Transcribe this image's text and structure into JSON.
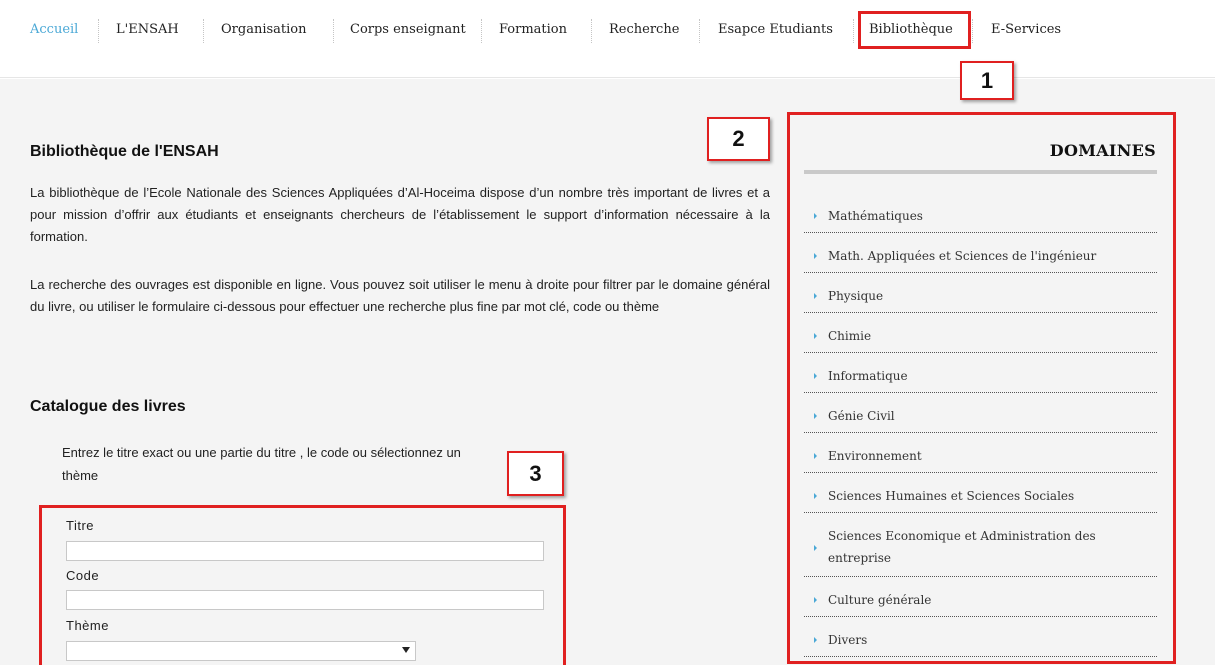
{
  "nav": {
    "items": [
      {
        "label": "Accueil",
        "active": true
      },
      {
        "label": "L'ENSAH",
        "active": false
      },
      {
        "label": "Organisation",
        "active": false
      },
      {
        "label": "Corps enseignant",
        "active": false
      },
      {
        "label": "Formation",
        "active": false
      },
      {
        "label": "Recherche",
        "active": false
      },
      {
        "label": "Esapce Etudiants",
        "active": false
      },
      {
        "label": "Bibliothèque",
        "active": false
      },
      {
        "label": "E-Services",
        "active": false
      }
    ]
  },
  "callouts": [
    "1",
    "2",
    "3"
  ],
  "main": {
    "title": "Bibliothèque de l'ENSAH",
    "paragraph1": "La bibliothèque de l’Ecole Nationale des Sciences Appliquées d’Al-Hoceima dispose d’un nombre très important de livres et a pour mission d’offrir aux étudiants et enseignants chercheurs de l’établissement le support d’information nécessaire à la formation.",
    "paragraph2": "La recherche des ouvrages est disponible en ligne. Vous pouvez soit utiliser le menu à droite pour filtrer par le domaine général du livre, ou utiliser le formulaire ci-dessous pour effectuer une recherche plus fine par mot clé, code ou thème",
    "catalogue_title": "Catalogue des livres",
    "instructions": "Entrez le titre exact ou une partie du titre , le code ou sélectionnez un thème"
  },
  "form": {
    "titre_label": "Titre",
    "titre_value": "",
    "code_label": "Code",
    "code_value": "",
    "theme_label": "Thème",
    "theme_selected": ""
  },
  "sidebar": {
    "title": "DOMAINES",
    "items": [
      "Mathématiques",
      "Math. Appliquées et Sciences de l'ingénieur",
      "Physique",
      "Chimie",
      "Informatique",
      "Génie Civil",
      "Environnement",
      "Sciences Humaines et Sciences Sociales",
      "Sciences Economique et Administration des entreprise",
      "Culture générale",
      "Divers"
    ]
  },
  "colors": {
    "accent": "#4aa8d6",
    "annotation": "#e02020",
    "background": "#f4f4f4"
  }
}
